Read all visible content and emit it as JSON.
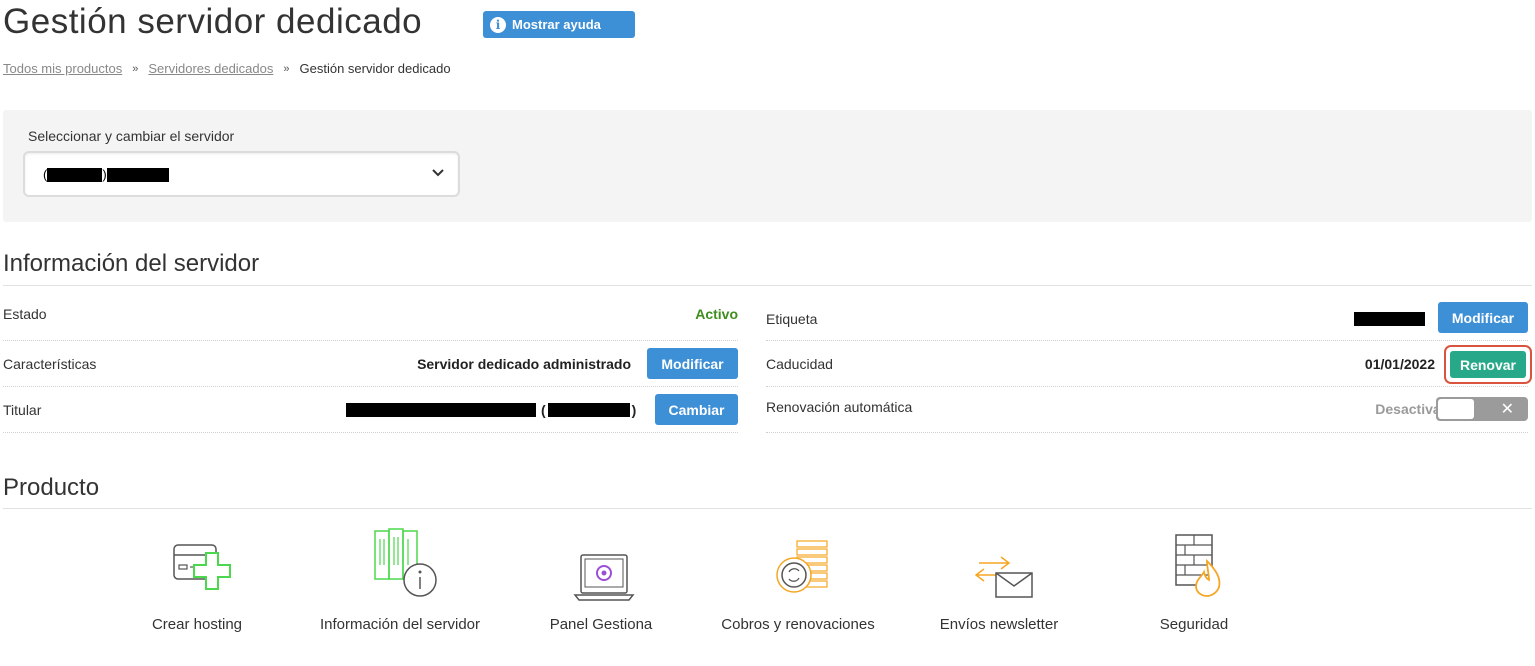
{
  "header": {
    "title": "Gestión servidor dedicado",
    "help_label": "Mostrar ayuda"
  },
  "breadcrumb": {
    "items": [
      "Todos mis productos",
      "Servidores dedicados",
      "Gestión servidor dedicado"
    ],
    "separator": "»"
  },
  "server_selector": {
    "label": "Seleccionar y cambiar el servidor",
    "value_prefix": "(",
    "value_mid": ")"
  },
  "server_info": {
    "title": "Información del servidor",
    "estado": {
      "label": "Estado",
      "value": "Activo"
    },
    "caracteristicas": {
      "label": "Características",
      "value": "Servidor dedicado administrado",
      "button": "Modificar"
    },
    "titular": {
      "label": "Titular",
      "open": "(",
      "close": ")",
      "button": "Cambiar"
    },
    "etiqueta": {
      "label": "Etiqueta",
      "button": "Modificar"
    },
    "caducidad": {
      "label": "Caducidad",
      "value": "01/01/2022",
      "button": "Renovar"
    },
    "renovacion": {
      "label": "Renovación automática",
      "value": "Desactivada",
      "toggle_symbol": "✕"
    }
  },
  "product": {
    "title": "Producto",
    "tiles": [
      {
        "label": "Crear hosting",
        "icon": "server-add-icon"
      },
      {
        "label": "Información del servidor",
        "icon": "server-info-icon"
      },
      {
        "label": "Panel Gestiona",
        "icon": "laptop-panel-icon"
      },
      {
        "label": "Cobros y renovaciones",
        "icon": "coins-renew-icon"
      },
      {
        "label": "Envíos newsletter",
        "icon": "newsletter-icon"
      },
      {
        "label": "Seguridad",
        "icon": "firewall-icon"
      }
    ]
  },
  "colors": {
    "primary_blue": "#3d8fd6",
    "active_green": "#3e8e1e",
    "renew_green": "#27a888",
    "highlight_red": "#d9543f",
    "icon_green": "#4cd84c",
    "icon_orange": "#f5a623"
  }
}
